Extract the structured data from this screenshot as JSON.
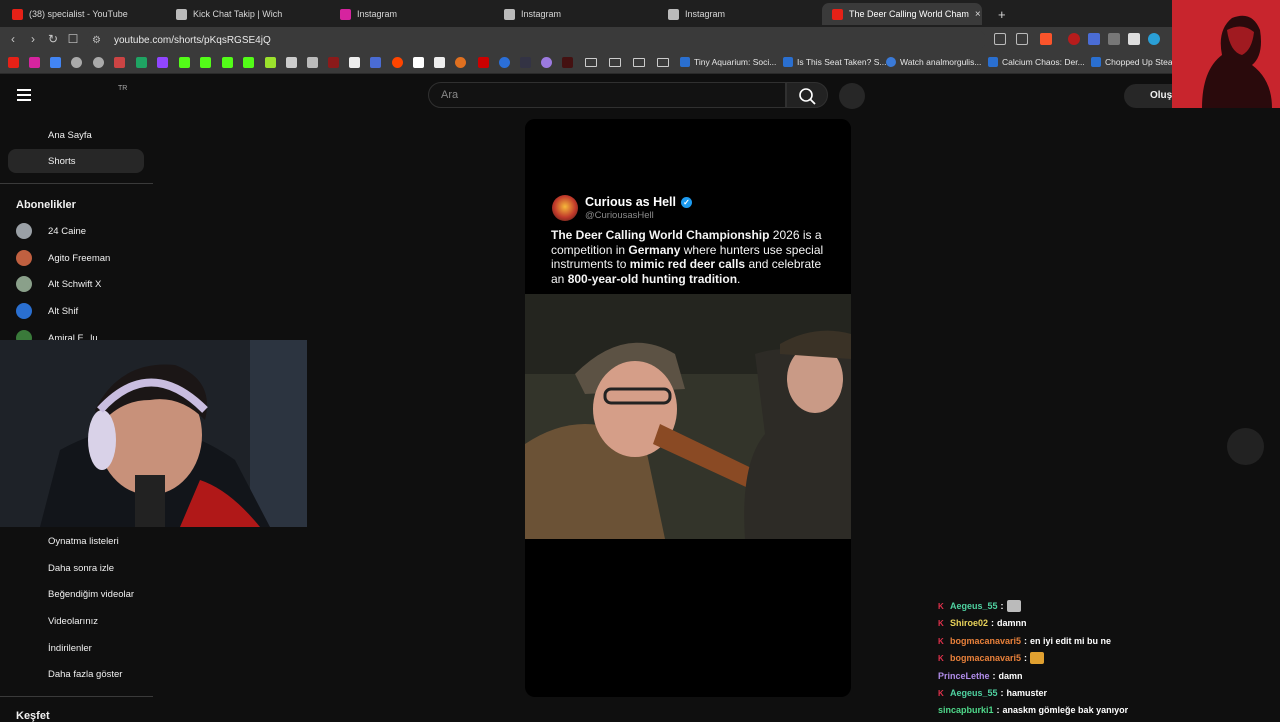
{
  "tabs": [
    {
      "title": "(38) specialist - YouTube",
      "favicon_color": "#e62117"
    },
    {
      "title": "Kick Chat Takip | Wich",
      "favicon_color": "#bbbbbb"
    },
    {
      "title": "Instagram",
      "favicon_color": "#d6249f"
    },
    {
      "title": "Instagram",
      "favicon_color": "#bbbbbb"
    },
    {
      "title": "Instagram",
      "favicon_color": "#bbbbbb"
    },
    {
      "title": "The Deer Calling World Cham",
      "favicon_color": "#e62117",
      "active": true
    }
  ],
  "address": {
    "url": "youtube.com/shorts/pKqsRGSE4jQ"
  },
  "bookmarks": [
    {
      "label": "Tiny Aquarium: Soci..."
    },
    {
      "label": "Is This Seat Taken? S..."
    },
    {
      "label": "Watch analmorgulis..."
    },
    {
      "label": "Calcium Chaos: Der..."
    },
    {
      "label": "Chopped Up Steam"
    }
  ],
  "youtube": {
    "region": "TR",
    "search_placeholder": "Ara",
    "create_label": "Oluştur"
  },
  "sidebar": {
    "main": [
      {
        "label": "Ana Sayfa"
      },
      {
        "label": "Shorts",
        "active": true
      }
    ],
    "subscriptions_heading": "Abonelikler",
    "subscriptions": [
      {
        "label": "24 Caine",
        "color": "#9aa0a6"
      },
      {
        "label": "Agito Freeman",
        "color": "#c06040"
      },
      {
        "label": "Alt Schwift X",
        "color": "#8aa08a"
      },
      {
        "label": "Alt Shif",
        "color": "#2a6fd0"
      },
      {
        "label": "Amiral F...lu",
        "color": "#3a7a3a"
      }
    ],
    "you_items": [
      {
        "label": "Oynatma listeleri"
      },
      {
        "label": "Daha sonra izle"
      },
      {
        "label": "Beğendiğim videolar"
      },
      {
        "label": "Videolarınız"
      },
      {
        "label": "İndirilenler"
      },
      {
        "label": "Daha fazla göster"
      }
    ],
    "explore_heading": "Keşfet"
  },
  "short": {
    "account_name": "Curious as Hell",
    "account_handle": "@CuriousasHell",
    "text_parts": [
      {
        "t": "The Deer Calling World Championship",
        "b": true
      },
      {
        "t": " 2026 is a competition in ",
        "b": false
      },
      {
        "t": "Germany",
        "b": true
      },
      {
        "t": " where hunters use special instruments to ",
        "b": false
      },
      {
        "t": "mimic red deer calls",
        "b": true
      },
      {
        "t": " and celebrate an ",
        "b": false
      },
      {
        "t": "800-year-old hunting tradition",
        "b": true
      },
      {
        "t": ".",
        "b": false
      }
    ]
  },
  "chat": [
    {
      "user": "Aegeus_55",
      "text": "",
      "color": "#4fd1a0",
      "kick": true,
      "emote": "#bbbbbb"
    },
    {
      "user": "Shiroe02",
      "text": "damnn",
      "color": "#e8d25a",
      "kick": true
    },
    {
      "user": "bogmacanavari5",
      "text": "en iyi edit mi bu ne",
      "color": "#e8803a",
      "kick": true
    },
    {
      "user": "bogmacanavari5",
      "text": "",
      "color": "#e8803a",
      "kick": true,
      "emote": "#e0a030"
    },
    {
      "user": "PrinceLethe",
      "text": "damn",
      "color": "#b08ce8",
      "kick": false
    },
    {
      "user": "Aegeus_55",
      "text": "hamuster",
      "color": "#4fd1a0",
      "kick": true
    },
    {
      "user": "sincapburki1",
      "text": "anaskm gömleğe bak yanıyor",
      "color": "#4fd88a",
      "kick": false
    }
  ]
}
